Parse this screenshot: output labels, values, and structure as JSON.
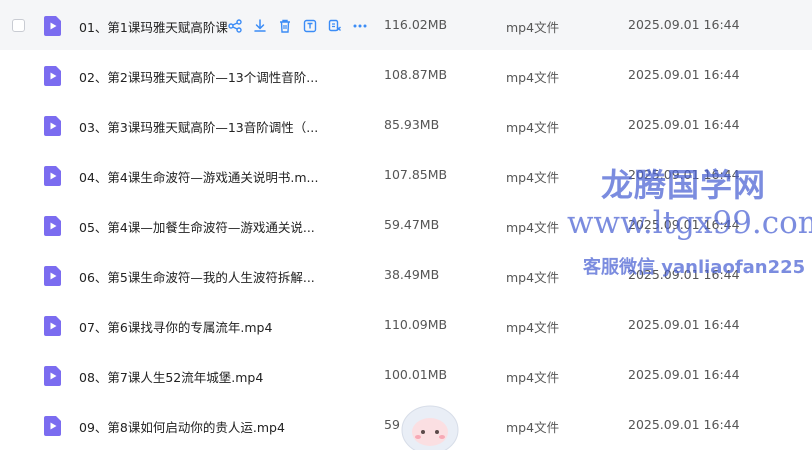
{
  "files": [
    {
      "name": "01、第1课玛雅天赋高阶课",
      "size": "116.02MB",
      "type": "mp4文件",
      "date": "2025.09.01 16:44"
    },
    {
      "name": "02、第2课玛雅天赋高阶—13个调性音阶...",
      "size": "108.87MB",
      "type": "mp4文件",
      "date": "2025.09.01 16:44"
    },
    {
      "name": "03、第3课玛雅天赋高阶—13音阶调性（...",
      "size": "85.93MB",
      "type": "mp4文件",
      "date": "2025.09.01 16:44"
    },
    {
      "name": "04、第4课生命波符—游戏通关说明书.m...",
      "size": "107.85MB",
      "type": "mp4文件",
      "date": "2025.09.01 16:44"
    },
    {
      "name": "05、第4课—加餐生命波符—游戏通关说...",
      "size": "59.47MB",
      "type": "mp4文件",
      "date": "2025.09.01 16:44"
    },
    {
      "name": "06、第5课生命波符—我的人生波符拆解...",
      "size": "38.49MB",
      "type": "mp4文件",
      "date": "2025.09.01 16:44"
    },
    {
      "name": "07、第6课找寻你的专属流年.mp4",
      "size": "110.09MB",
      "type": "mp4文件",
      "date": "2025.09.01 16:44"
    },
    {
      "name": "08、第7课人生52流年城堡.mp4",
      "size": "100.01MB",
      "type": "mp4文件",
      "date": "2025.09.01 16:44"
    },
    {
      "name": "09、第8课如何启动你的贵人运.mp4",
      "size": "59",
      "type": "mp4文件",
      "date": "2025.09.01 16:44"
    }
  ],
  "row_actions": [
    "share-icon",
    "download-icon",
    "delete-icon",
    "rename-icon",
    "copy-icon",
    "more-icon"
  ],
  "watermark": {
    "line1": "龙腾国学网",
    "line2": "www.ltgx99.com",
    "line3": "客服微信 yanliaofan225"
  },
  "colors": {
    "file_icon": "#7b6cf0",
    "action_icon": "#3b8cf6",
    "row_hover": "#f5f6f8",
    "watermark": "#4860d2"
  }
}
